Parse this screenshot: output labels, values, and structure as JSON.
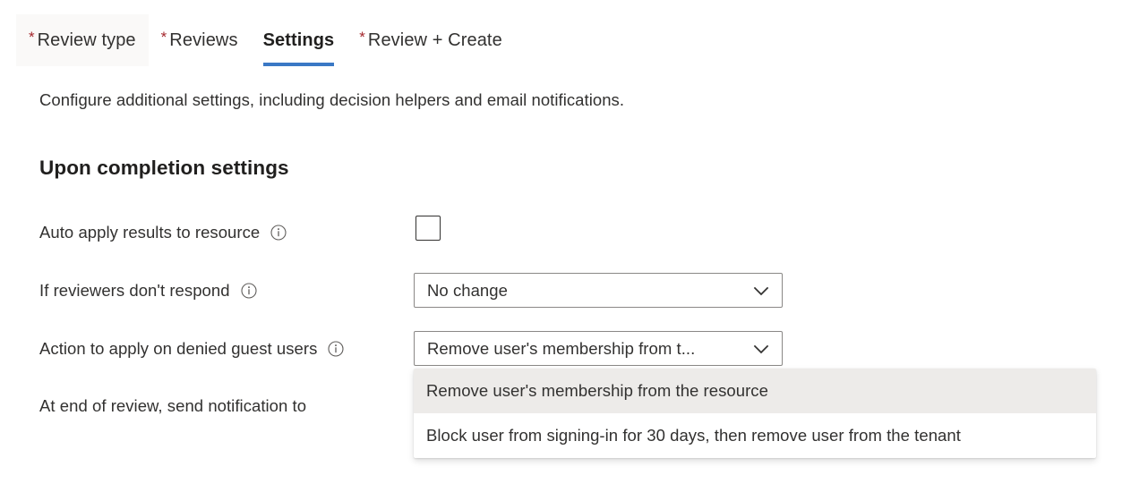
{
  "tabs": [
    {
      "label": "Review type",
      "required": true,
      "state": "hovered",
      "name": "tab-review-type"
    },
    {
      "label": "Reviews",
      "required": true,
      "state": "normal",
      "name": "tab-reviews"
    },
    {
      "label": "Settings",
      "required": false,
      "state": "active",
      "name": "tab-settings"
    },
    {
      "label": "Review + Create",
      "required": true,
      "state": "normal",
      "name": "tab-review-create"
    }
  ],
  "required_marker": "*",
  "page": {
    "intro": "Configure additional settings, including decision helpers and email notifications.",
    "section_heading": "Upon completion settings"
  },
  "rows": {
    "auto_apply": {
      "label": "Auto apply results to resource",
      "has_info": true,
      "checkbox_checked": false
    },
    "no_respond": {
      "label": "If reviewers don't respond",
      "has_info": true,
      "value": "No change"
    },
    "denied_guest": {
      "label": "Action to apply on denied guest users",
      "has_info": true,
      "value": "Remove user's membership from t...",
      "expanded": true,
      "options": [
        {
          "label": "Remove user's membership from the resource",
          "selected": true
        },
        {
          "label": "Block user from signing-in for 30 days, then remove user from the tenant",
          "selected": false
        }
      ]
    },
    "notify": {
      "label": "At end of review, send notification to",
      "has_info": false
    }
  },
  "colors": {
    "accent": "#3a78c5",
    "required_asterisk": "#a4262c",
    "text": "#323130",
    "border": "#8a8886",
    "option_selected_bg": "#edebe9",
    "tab_hover_bg": "#faf9f8"
  },
  "icons": {
    "info": "info-icon",
    "chevron_down": "chevron-down-icon"
  }
}
